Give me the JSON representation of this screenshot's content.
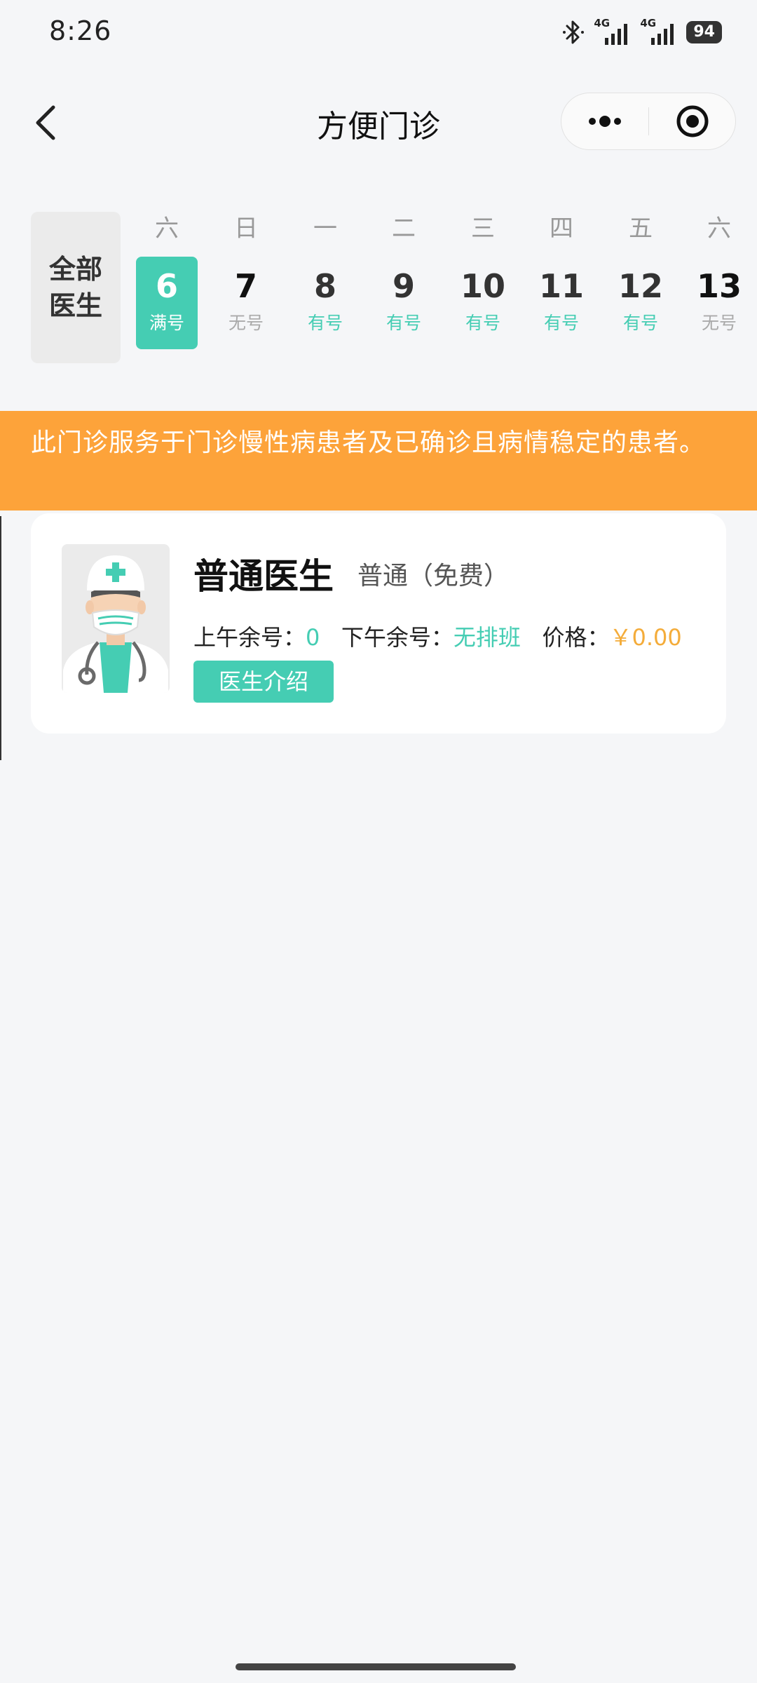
{
  "status_bar": {
    "time": "8:26",
    "network_1": "4G",
    "network_2": "4G",
    "battery": "94"
  },
  "nav": {
    "title": "方便门诊",
    "back_icon": "chevron-left-icon",
    "more_icon": "more-dots-icon",
    "close_icon": "target-circle-icon"
  },
  "date_selector": {
    "all_doctors_label": "全部\n医生",
    "days": [
      {
        "weekday": "六",
        "date": "6",
        "availability": "满号",
        "state": "selected"
      },
      {
        "weekday": "日",
        "date": "7",
        "availability": "无号",
        "state": "none"
      },
      {
        "weekday": "一",
        "date": "8",
        "availability": "有号",
        "state": "has"
      },
      {
        "weekday": "二",
        "date": "9",
        "availability": "有号",
        "state": "has"
      },
      {
        "weekday": "三",
        "date": "10",
        "availability": "有号",
        "state": "has"
      },
      {
        "weekday": "四",
        "date": "11",
        "availability": "有号",
        "state": "has"
      },
      {
        "weekday": "五",
        "date": "12",
        "availability": "有号",
        "state": "has"
      },
      {
        "weekday": "六",
        "date": "13",
        "availability": "无号",
        "state": "none"
      }
    ]
  },
  "notice": {
    "text": "此门诊服务于门诊慢性病患者及已确诊且病情稳定的患者。"
  },
  "doctor": {
    "name": "普通医生",
    "type": "普通（免费）",
    "morning_label": "上午余号：",
    "morning_value": "0",
    "afternoon_label": "下午余号：",
    "afternoon_value": "无排班",
    "price_label": "价格：",
    "price_value": "￥0.00",
    "intro_button": "医生介绍"
  },
  "colors": {
    "accent": "#45cdb3",
    "notice_bg": "#fda33a",
    "price": "#f4ac3a",
    "page_bg": "#f5f6f8"
  }
}
